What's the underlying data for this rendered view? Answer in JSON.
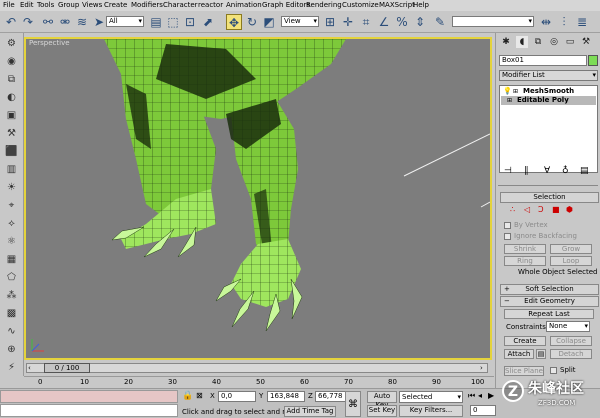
{
  "menu": [
    "File",
    "Edit",
    "Tools",
    "Group",
    "Views",
    "Create",
    "Modifiers",
    "Character",
    "reactor",
    "Animation",
    "Graph Editors",
    "Rendering",
    "Customize",
    "MAXScript",
    "Help"
  ],
  "toolbar": {
    "selection_filter": "All",
    "ref_coord": "View"
  },
  "viewport": {
    "label": "Perspective"
  },
  "timeslider": {
    "frame_label": "0 / 100",
    "ticks": [
      "0",
      "10",
      "20",
      "30",
      "40",
      "50",
      "60",
      "70",
      "80",
      "90",
      "100"
    ]
  },
  "command_panel": {
    "object_name": "Box01",
    "modifier_list": "Modifier List",
    "stack": [
      "MeshSmooth",
      "Editable Poly"
    ],
    "selection": {
      "title": "Selection",
      "by_vertex": "By Vertex",
      "ignore_backfacing": "Ignore Backfacing",
      "shrink": "Shrink",
      "grow": "Grow",
      "ring": "Ring",
      "loop": "Loop",
      "status": "Whole Object Selected"
    },
    "soft_selection": {
      "title": "Soft Selection"
    },
    "edit_geometry": {
      "title": "Edit Geometry",
      "repeat_last": "Repeat Last",
      "constraints_label": "Constraints:",
      "constraints_value": "None",
      "create": "Create",
      "collapse": "Collapse",
      "attach": "Attach",
      "detach": "Detach",
      "slice_plane": "Slice Plane",
      "split": "Split"
    }
  },
  "status": {
    "coord_x_label": "X",
    "coord_x": "0,0",
    "coord_y_label": "Y",
    "coord_y": "163,848",
    "coord_z_label": "Z",
    "coord_z": "66,778",
    "prompt": "Click and drag to select and move",
    "add_time_tag": "Add Time Tag",
    "auto_key": "Auto Key",
    "set_key": "Set Key",
    "selected": "Selected",
    "key_filters": "Key Filters...",
    "frame": "0"
  },
  "watermark": "朱峰社区",
  "watermark_sub": "ZF3D.COM",
  "colors": {
    "viewport_bg": "#7d7d7d",
    "active_border": "#e4d33c",
    "mesh_green": "#7dc93a",
    "mesh_dark": "#1f3a10",
    "object_color": "#7ddc56",
    "autokey_red": "#e9b2b2"
  }
}
